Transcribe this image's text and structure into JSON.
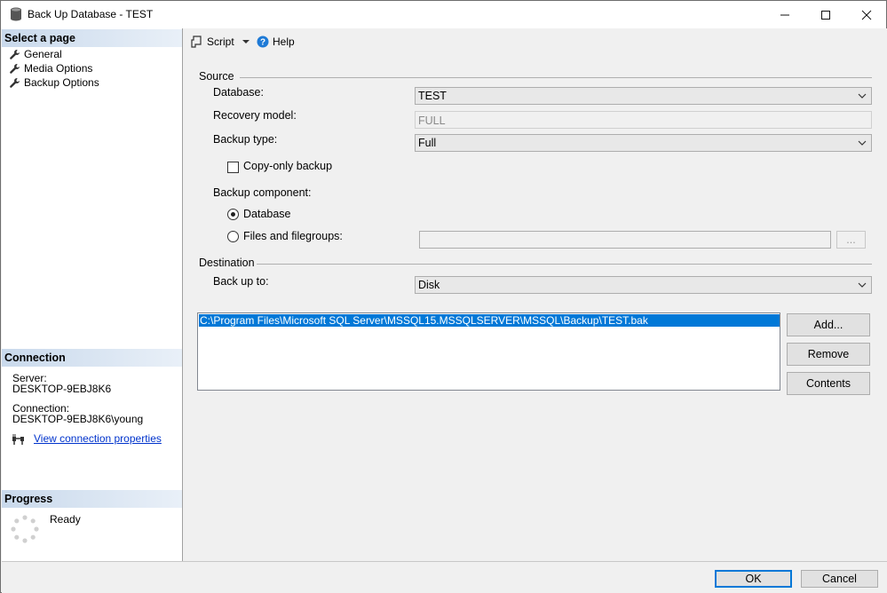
{
  "window": {
    "title": "Back Up Database - TEST",
    "minimize_glyph": "—",
    "maximize_glyph": "☐",
    "close_glyph": "✕"
  },
  "sidebar": {
    "select_page_header": "Select a page",
    "pages": [
      {
        "label": "General",
        "icon": "wrench-icon"
      },
      {
        "label": "Media Options",
        "icon": "wrench-icon"
      },
      {
        "label": "Backup Options",
        "icon": "wrench-icon"
      }
    ],
    "connection_header": "Connection",
    "server_label": "Server:",
    "server_value": "DESKTOP-9EBJ8K6",
    "connection_label": "Connection:",
    "connection_value": "DESKTOP-9EBJ8K6\\young",
    "view_connection_link": "View connection properties",
    "progress_header": "Progress",
    "progress_status": "Ready"
  },
  "toolbar": {
    "script_label": "Script",
    "help_label": "Help"
  },
  "source": {
    "section_label": "Source",
    "database_label": "Database:",
    "database_value": "TEST",
    "recovery_model_label": "Recovery model:",
    "recovery_model_value": "FULL",
    "backup_type_label": "Backup type:",
    "backup_type_value": "Full",
    "copy_only_label": "Copy-only backup",
    "copy_only_checked": false,
    "backup_component_label": "Backup component:",
    "component_database_label": "Database",
    "component_files_label": "Files and filegroups:",
    "files_browse_label": "...",
    "files_value": ""
  },
  "destination": {
    "section_label": "Destination",
    "back_up_to_label": "Back up to:",
    "back_up_to_value": "Disk",
    "paths": [
      "C:\\Program Files\\Microsoft SQL Server\\MSSQL15.MSSQLSERVER\\MSSQL\\Backup\\TEST.bak"
    ],
    "add_label": "Add...",
    "remove_label": "Remove",
    "contents_label": "Contents"
  },
  "footer": {
    "ok_label": "OK",
    "cancel_label": "Cancel"
  },
  "colors": {
    "accent": "#0078d7",
    "header_gradient_start": "#c9d9ec",
    "link": "#0033cc"
  }
}
